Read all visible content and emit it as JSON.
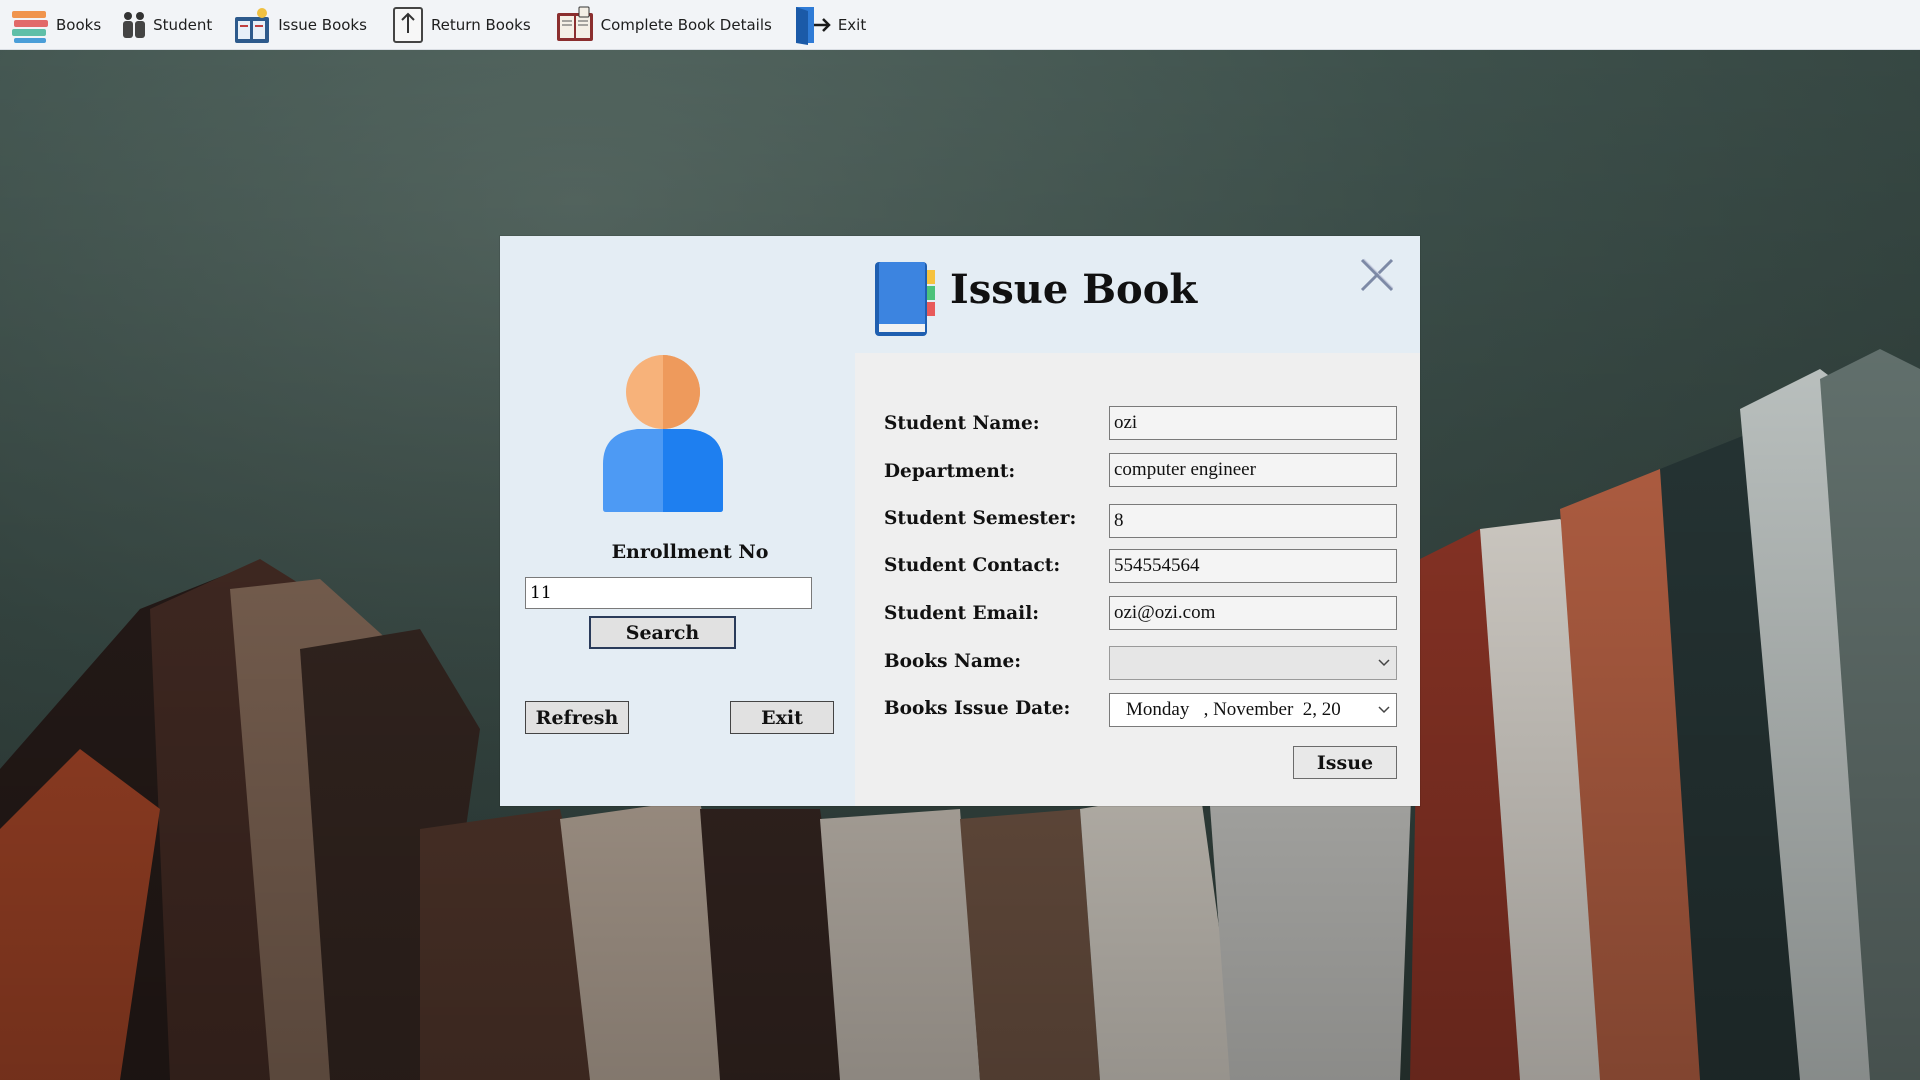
{
  "menu": {
    "items": [
      {
        "label": "Books",
        "icon": "books-stack-icon"
      },
      {
        "label": "Student",
        "icon": "students-icon"
      },
      {
        "label": "Issue Books",
        "icon": "issue-books-icon"
      },
      {
        "label": "Return Books",
        "icon": "return-books-icon"
      },
      {
        "label": "Complete Book Details",
        "icon": "book-details-icon"
      },
      {
        "label": "Exit",
        "icon": "exit-door-icon"
      }
    ]
  },
  "dialog": {
    "title": "Issue Book",
    "left": {
      "enrollment_label": "Enrollment No",
      "enrollment_value": "11",
      "search_label": "Search",
      "refresh_label": "Refresh",
      "exit_label": "Exit"
    },
    "form": {
      "student_name_label": "Student Name:",
      "student_name_value": "ozi",
      "department_label": "Department:",
      "department_value": "computer engineer",
      "semester_label": "Student Semester:",
      "semester_value": "8",
      "contact_label": "Student Contact:",
      "contact_value": "554554564",
      "email_label": "Student Email:",
      "email_value": "ozi@ozi.com",
      "books_name_label": "Books Name:",
      "books_name_value": "",
      "issue_date_label": "Books Issue Date:",
      "issue_date_value": "Monday   , November  2, 20",
      "issue_button_label": "Issue"
    }
  },
  "colors": {
    "menubar_bg": "#f2f4f7",
    "dialog_left_bg": "#e4edf4",
    "dialog_right_bg": "#efefef",
    "button_border": "#2a3b5a",
    "avatar_head": "#f4a468",
    "avatar_body": "#3d8ef0"
  }
}
